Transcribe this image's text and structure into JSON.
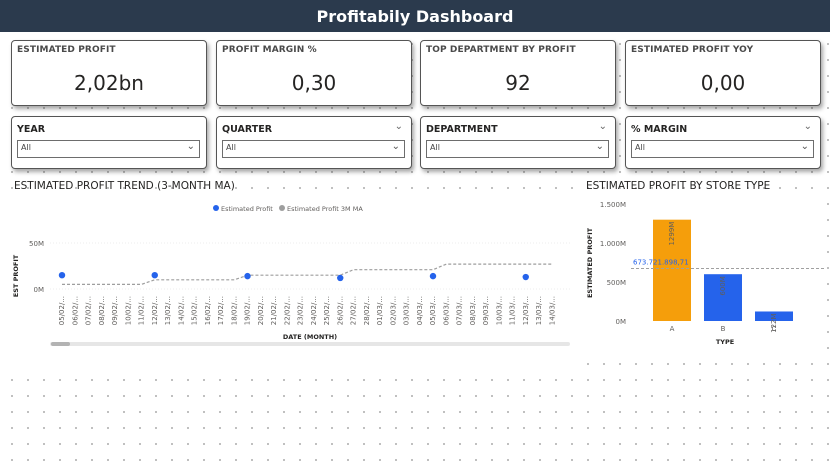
{
  "header": {
    "title": "Profitabily Dashboard"
  },
  "kpis": [
    {
      "title": "ESTIMATED PROFIT",
      "value": "2,02bn"
    },
    {
      "title": "PROFIT MARGIN %",
      "value": "0,30"
    },
    {
      "title": "TOP DEPARTMENT BY PROFIT",
      "value": "92"
    },
    {
      "title": "ESTIMATED PROFIT YOY",
      "value": "0,00"
    }
  ],
  "slicers": [
    {
      "title": "YEAR",
      "value": "All",
      "has_header_chevron": false
    },
    {
      "title": "QUARTER",
      "value": "All",
      "has_header_chevron": true
    },
    {
      "title": "DEPARTMENT",
      "value": "All",
      "has_header_chevron": true
    },
    {
      "title": "% MARGIN",
      "value": "All",
      "has_header_chevron": true
    }
  ],
  "trend": {
    "title": "ESTIMATED PROFIT TREND (3-MONTH MA)",
    "legend": [
      {
        "name": "Estimated Profit",
        "color": "#2563eb"
      },
      {
        "name": "Estimated Profit 3M MA",
        "color": "#9e9e9e"
      }
    ],
    "y_axis_title": "EST PROFIT",
    "x_axis_title": "DATE (MONTH)",
    "y_ticks": [
      "50M",
      "0M"
    ]
  },
  "store_type": {
    "title": "ESTIMATED PROFIT BY STORE TYPE",
    "y_axis_title": "ESTIMATED PROFIT",
    "x_axis_title": "TYPE",
    "avg_label": "673.721.898,71",
    "y_ticks": [
      "1.500M",
      "1.000M",
      "500M",
      "0M"
    ]
  },
  "chart_data": [
    {
      "type": "line",
      "title": "ESTIMATED PROFIT TREND (3-MONTH MA)",
      "xlabel": "DATE (MONTH)",
      "ylabel": "EST PROFIT",
      "ylim": [
        -6,
        64
      ],
      "x": [
        "05/02/...",
        "06/02/...",
        "07/02/...",
        "08/02/...",
        "09/02/...",
        "10/02/...",
        "11/02/...",
        "12/02/...",
        "13/02/...",
        "14/02/...",
        "15/02/...",
        "16/02/...",
        "17/02/...",
        "18/02/...",
        "19/02/...",
        "20/02/...",
        "21/02/...",
        "22/02/...",
        "23/02/...",
        "24/02/...",
        "25/02/...",
        "26/02/...",
        "27/02/...",
        "28/02/...",
        "01/03/...",
        "02/03/...",
        "03/03/...",
        "04/03/...",
        "05/03/...",
        "06/03/...",
        "07/03/...",
        "08/03/...",
        "09/03/...",
        "10/03/...",
        "11/03/...",
        "12/03/...",
        "13/03/...",
        "14/03/..."
      ],
      "series": [
        {
          "name": "Estimated Profit",
          "color": "#2563eb",
          "points": [
            [
              0,
              15
            ],
            [
              7,
              15
            ],
            [
              14,
              14
            ],
            [
              21,
              12
            ],
            [
              28,
              14
            ],
            [
              35,
              13
            ]
          ]
        },
        {
          "name": "Estimated Profit 3M MA",
          "color": "#9e9e9e",
          "points": [
            [
              0,
              5
            ],
            [
              6,
              5
            ],
            [
              7,
              10
            ],
            [
              13,
              10
            ],
            [
              14,
              15
            ],
            [
              21,
              15
            ],
            [
              22,
              21
            ],
            [
              28,
              21
            ],
            [
              29,
              27
            ],
            [
              35,
              27
            ],
            [
              37,
              27
            ]
          ]
        }
      ]
    },
    {
      "type": "bar",
      "title": "ESTIMATED PROFIT BY STORE TYPE",
      "xlabel": "TYPE",
      "ylabel": "ESTIMATED PROFIT",
      "ylim": [
        0,
        1500
      ],
      "categories": [
        "A",
        "B",
        "C"
      ],
      "values": [
        1299,
        600,
        122
      ],
      "labels": [
        "1299M",
        "600M",
        "122M"
      ],
      "colors": [
        "#f59e0b",
        "#2563eb",
        "#2563eb"
      ],
      "average_line": 673.72
    }
  ]
}
